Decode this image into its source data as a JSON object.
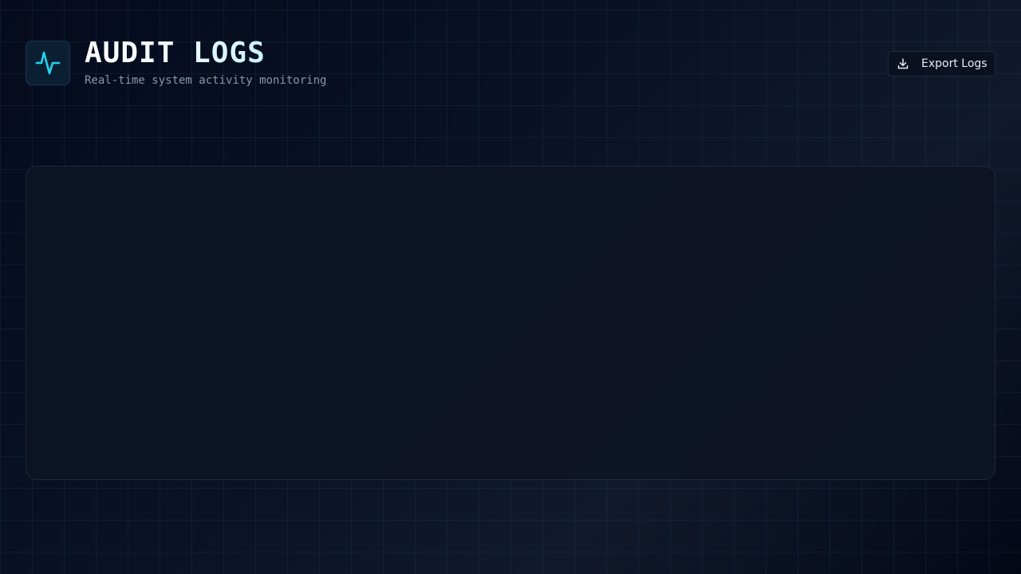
{
  "header": {
    "title": "AUDIT LOGS",
    "subtitle": "Real-time system activity monitoring",
    "logo_icon": "activity-pulse-icon"
  },
  "toolbar": {
    "export_label": "Export Logs",
    "export_icon": "download-icon"
  },
  "colors": {
    "accent": "#22d3ee",
    "background": "#0a1226",
    "panel": "#0d1424"
  }
}
